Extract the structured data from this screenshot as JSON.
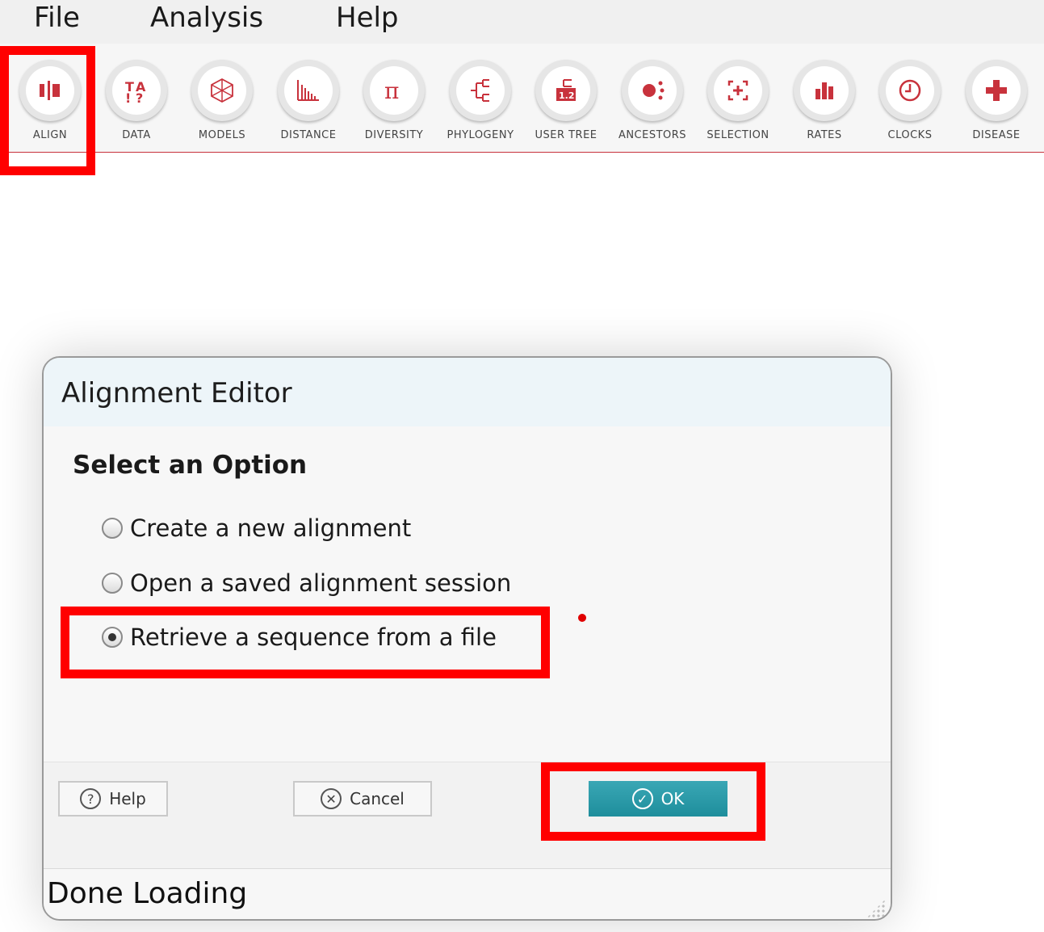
{
  "menu": {
    "file": "File",
    "analysis": "Analysis",
    "help": "Help"
  },
  "toolbar": {
    "accent_color": "#c8323c",
    "items": [
      {
        "label": "ALIGN",
        "icon": "align-icon"
      },
      {
        "label": "DATA",
        "icon": "data-icon"
      },
      {
        "label": "MODELS",
        "icon": "models-icon"
      },
      {
        "label": "DISTANCE",
        "icon": "distance-icon"
      },
      {
        "label": "DIVERSITY",
        "icon": "diversity-icon"
      },
      {
        "label": "PHYLOGENY",
        "icon": "phylogeny-icon"
      },
      {
        "label": "USER TREE",
        "icon": "user-tree-icon"
      },
      {
        "label": "ANCESTORS",
        "icon": "ancestors-icon"
      },
      {
        "label": "SELECTION",
        "icon": "selection-icon"
      },
      {
        "label": "RATES",
        "icon": "rates-icon"
      },
      {
        "label": "CLOCKS",
        "icon": "clocks-icon"
      },
      {
        "label": "DISEASE",
        "icon": "disease-icon"
      }
    ]
  },
  "dialog": {
    "title": "Alignment Editor",
    "section_title": "Select an Option",
    "options": [
      {
        "label": "Create a new alignment",
        "checked": false
      },
      {
        "label": "Open a saved alignment session",
        "checked": false
      },
      {
        "label": "Retrieve a sequence from a file",
        "checked": true
      }
    ],
    "buttons": {
      "help": "Help",
      "cancel": "Cancel",
      "ok": "OK"
    },
    "ok_color": "#2a9ba9",
    "status": "Done Loading"
  },
  "highlight_color": "#ff0000"
}
